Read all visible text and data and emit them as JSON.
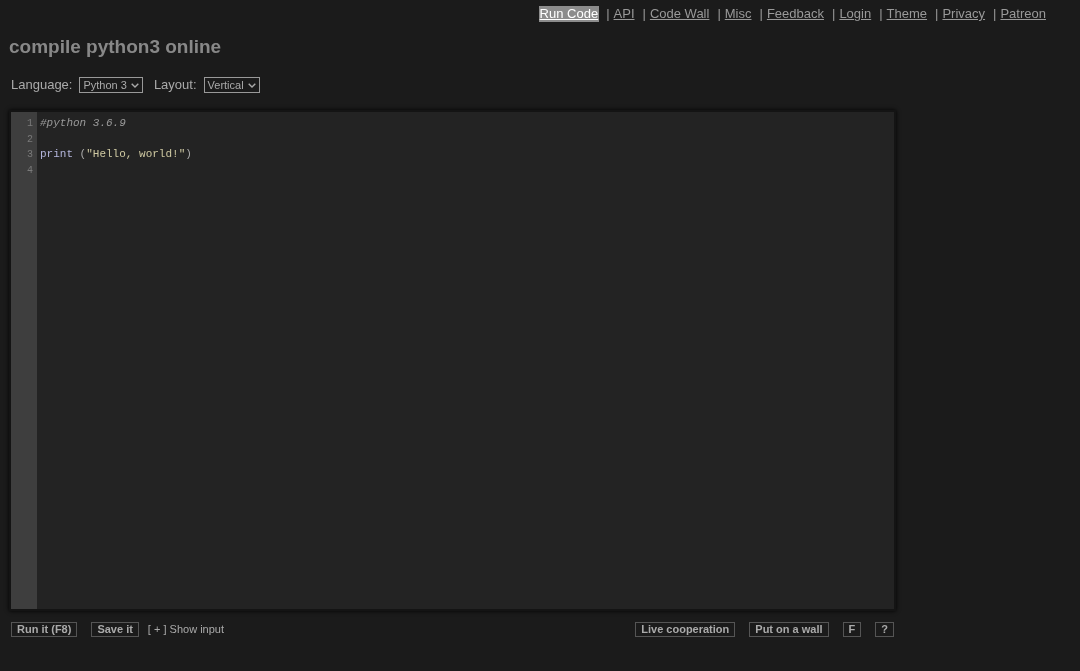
{
  "nav": [
    {
      "label": "Run Code",
      "selected": true
    },
    {
      "separator": "|",
      "label": "API",
      "selected": false
    },
    {
      "separator": "|",
      "label": "Code Wall",
      "selected": false
    },
    {
      "separator": "|",
      "label": "Misc",
      "selected": false
    },
    {
      "separator": "|",
      "label": "Feedback",
      "selected": false
    },
    {
      "separator": "|",
      "label": "Login",
      "selected": false
    },
    {
      "separator": "|",
      "label": "Theme",
      "selected": false
    },
    {
      "separator": "|",
      "label": "Privacy",
      "selected": false
    },
    {
      "separator": "|",
      "label": "Patreon",
      "selected": false
    }
  ],
  "title": "compile python3 online",
  "options": [
    {
      "label": "Language:",
      "value": "Python 3"
    },
    {
      "label": "Layout:",
      "value": "Vertical"
    }
  ],
  "editor": {
    "lines": [
      {
        "number": "1",
        "tokens": [
          {
            "kind": "comment",
            "text": "#python 3.6.9"
          }
        ]
      },
      {
        "number": "2"
      },
      {
        "number": "3",
        "tokens": [
          {
            "kind": "keyword",
            "text": "print"
          },
          {
            "kind": "plain",
            "text": " ("
          },
          {
            "kind": "string",
            "text": "\"Hello, world!\""
          },
          {
            "kind": "plain",
            "text": ")"
          }
        ]
      },
      {
        "number": "4"
      }
    ]
  },
  "actions_left": [
    {
      "kind": "button",
      "label": "Run it (F8)"
    },
    {
      "kind": "button",
      "label": "Save it"
    },
    {
      "kind": "link",
      "label": "[ + ] Show input"
    }
  ],
  "actions_right": [
    {
      "kind": "button",
      "label": "Live cooperation"
    },
    {
      "kind": "button",
      "label": "Put on a wall"
    },
    {
      "kind": "button",
      "label": "F"
    },
    {
      "kind": "button",
      "label": "?"
    }
  ]
}
